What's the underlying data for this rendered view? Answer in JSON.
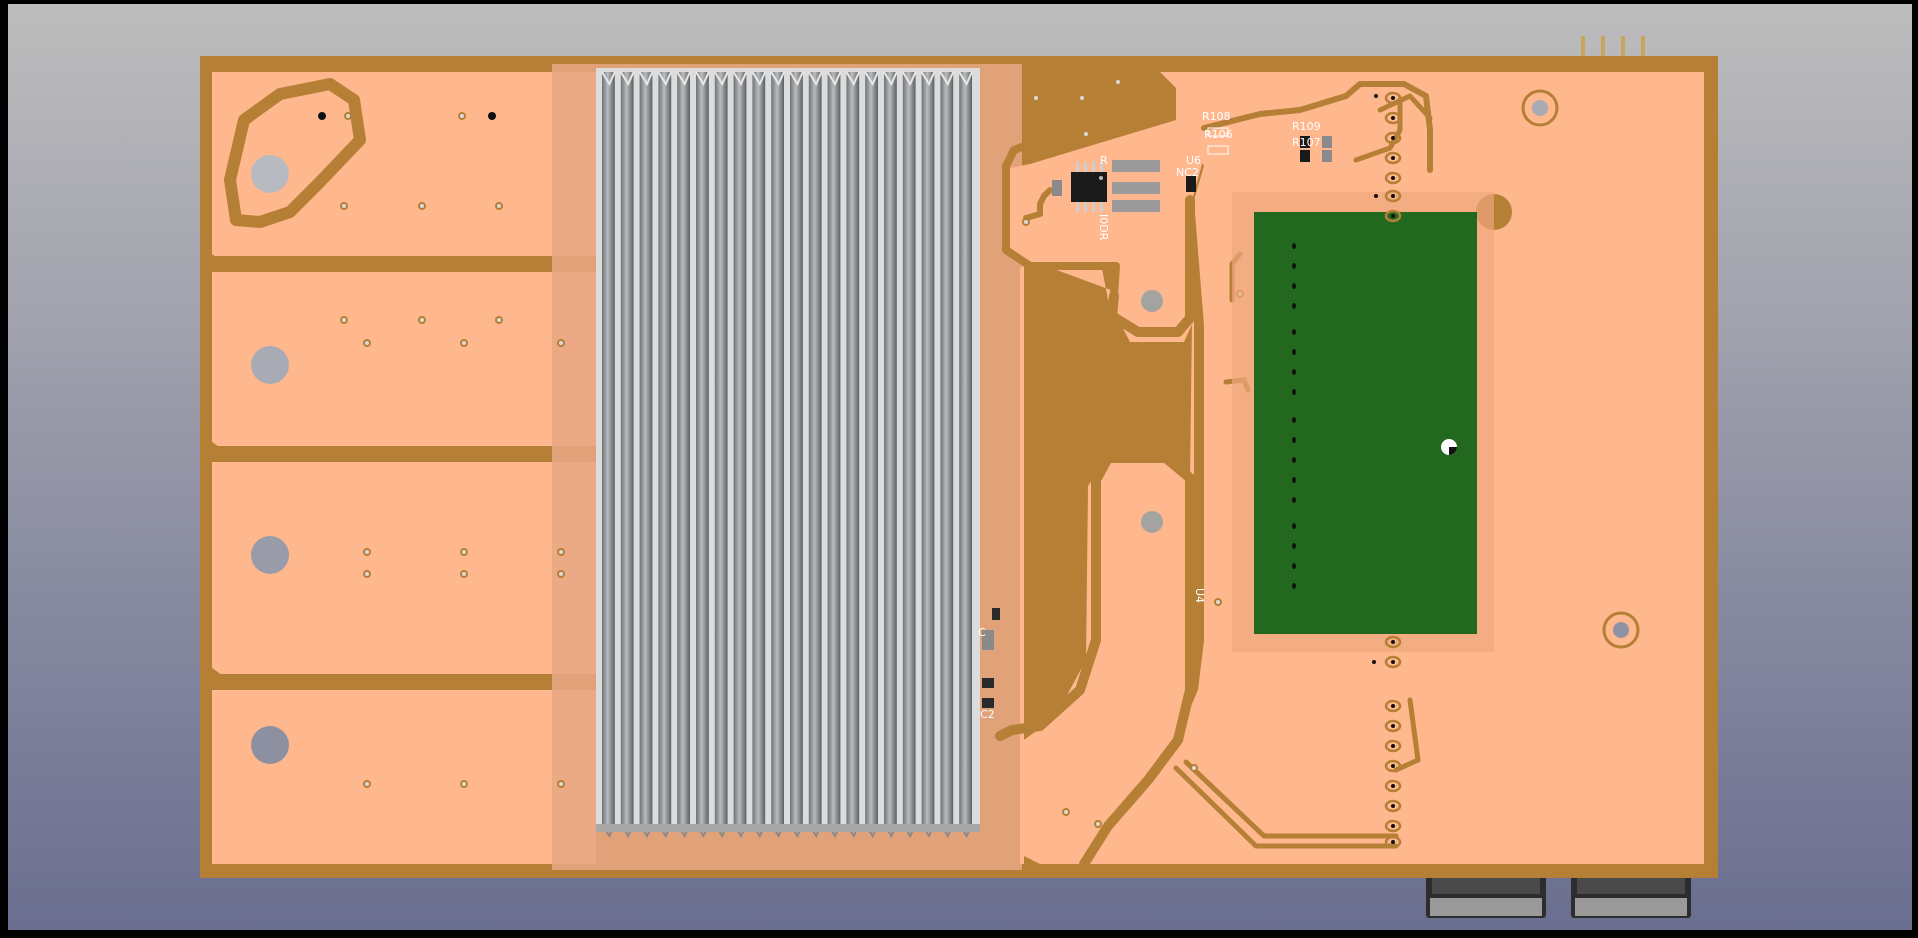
{
  "viewer": {
    "background_top": "#bdbdbd",
    "background_bottom": "#6a6e8f",
    "frame_color": "#000000"
  },
  "board": {
    "mask_color": "#ffb78e",
    "copper_color": "#b57f35",
    "silk_color": "#ffffff",
    "module_color": "#22691f"
  },
  "silkscreen": {
    "r108": "R108",
    "r106": "R106",
    "r109": "R109",
    "r107": "R107",
    "u6": "U6",
    "r_left": "R",
    "r_vertical": "R",
    "c_vertical": "C",
    "ic_text": "I0DR",
    "nc_label": "NC2",
    "u4": "U4",
    "c_small": "C",
    "c2": "C2"
  },
  "components": [
    {
      "name": "heatsink-fins",
      "count": 20
    },
    {
      "name": "wireless-module"
    },
    {
      "name": "soic-8-chip"
    },
    {
      "name": "sot23-u6"
    },
    {
      "name": "usb-connector-left"
    },
    {
      "name": "usb-connector-right"
    },
    {
      "name": "pin-header-4"
    }
  ]
}
